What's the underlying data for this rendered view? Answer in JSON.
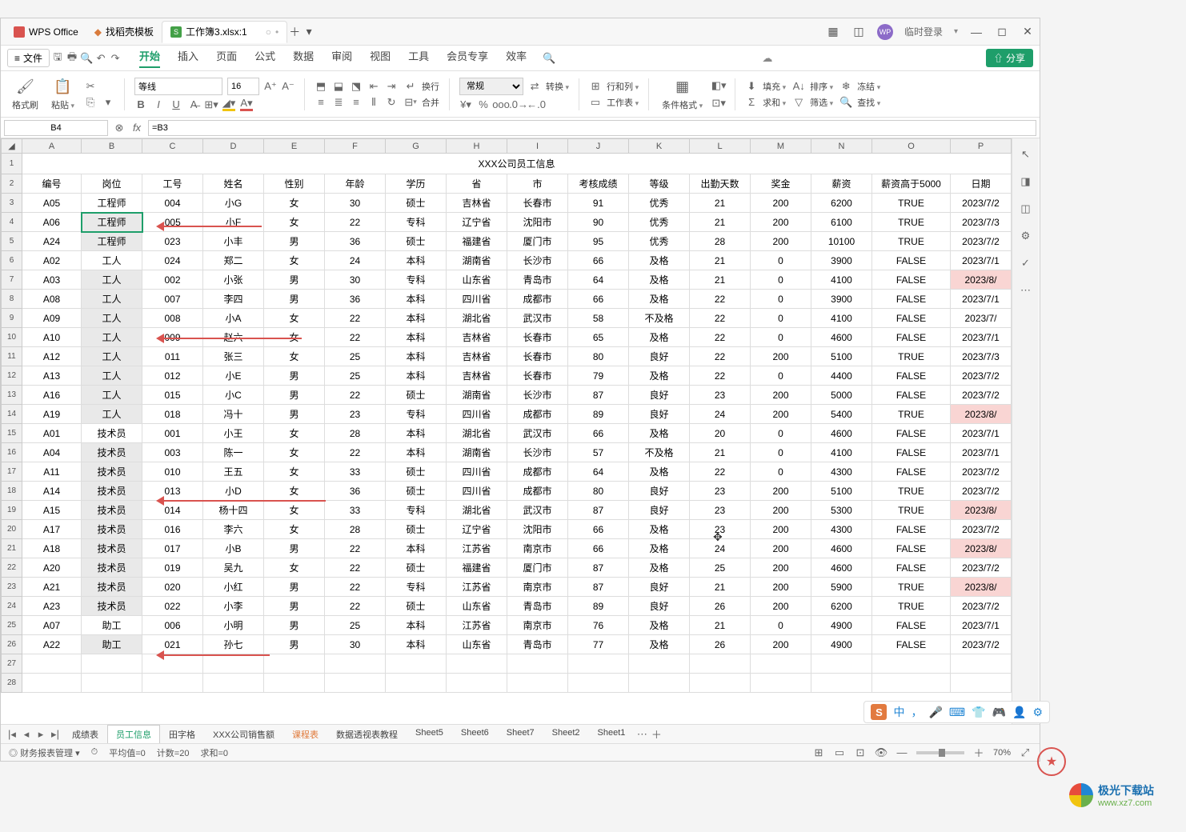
{
  "titlebar": {
    "app": "WPS Office",
    "tab_template": "找稻壳模板",
    "active_tab": "工作簿3.xlsx:1",
    "login": "临时登录"
  },
  "menubar": {
    "file": "文件",
    "tabs": [
      "开始",
      "插入",
      "页面",
      "公式",
      "数据",
      "审阅",
      "视图",
      "工具",
      "会员专享",
      "效率"
    ],
    "share": "分享"
  },
  "ribbon": {
    "format_painter": "格式刷",
    "paste": "粘贴",
    "font_name": "等线",
    "font_size": "16",
    "wrap": "换行",
    "merge": "合并",
    "number_fmt": "常规",
    "convert": "转换",
    "rowcol": "行和列",
    "sheet": "工作表",
    "cond_fmt": "条件格式",
    "fill": "填充",
    "sort": "排序",
    "freeze": "冻结",
    "sum": "求和",
    "filter": "筛选",
    "find": "查找"
  },
  "cellref": {
    "name": "B4",
    "formula": "=B3"
  },
  "columns": [
    "A",
    "B",
    "C",
    "D",
    "E",
    "F",
    "G",
    "H",
    "I",
    "J",
    "K",
    "L",
    "M",
    "N",
    "O",
    "P"
  ],
  "title": "XXX公司员工信息",
  "headers": [
    "编号",
    "岗位",
    "工号",
    "姓名",
    "性别",
    "年龄",
    "",
    "学历",
    "省",
    "市",
    "考核成绩",
    "等级",
    "出勤天数",
    "奖金",
    "薪资",
    "薪资高于5000",
    "日期"
  ],
  "rows": [
    {
      "n": 3,
      "g": 0,
      "hl": 0,
      "c": [
        "A05",
        "工程师",
        "004",
        "小G",
        "女",
        "30",
        "",
        "硕士",
        "吉林省",
        "长春市",
        "91",
        "优秀",
        "21",
        "200",
        "6200",
        "TRUE",
        "2023/7/2"
      ]
    },
    {
      "n": 4,
      "g": 1,
      "hl": 0,
      "sel": 1,
      "c": [
        "A06",
        "工程师",
        "005",
        "小F",
        "女",
        "22",
        "",
        "专科",
        "辽宁省",
        "沈阳市",
        "90",
        "优秀",
        "21",
        "200",
        "6100",
        "TRUE",
        "2023/7/3"
      ]
    },
    {
      "n": 5,
      "g": 1,
      "hl": 0,
      "c": [
        "A24",
        "工程师",
        "023",
        "小丰",
        "男",
        "36",
        "",
        "硕士",
        "福建省",
        "厦门市",
        "95",
        "优秀",
        "28",
        "200",
        "10100",
        "TRUE",
        "2023/7/2"
      ]
    },
    {
      "n": 6,
      "g": 0,
      "hl": 0,
      "c": [
        "A02",
        "工人",
        "024",
        "郑二",
        "女",
        "24",
        "",
        "本科",
        "湖南省",
        "长沙市",
        "66",
        "及格",
        "21",
        "0",
        "3900",
        "FALSE",
        "2023/7/1"
      ]
    },
    {
      "n": 7,
      "g": 1,
      "hl": 1,
      "c": [
        "A03",
        "工人",
        "002",
        "小张",
        "男",
        "30",
        "",
        "专科",
        "山东省",
        "青岛市",
        "64",
        "及格",
        "21",
        "0",
        "4100",
        "FALSE",
        "2023/8/"
      ]
    },
    {
      "n": 8,
      "g": 1,
      "hl": 0,
      "c": [
        "A08",
        "工人",
        "007",
        "李四",
        "男",
        "36",
        "",
        "本科",
        "四川省",
        "成都市",
        "66",
        "及格",
        "22",
        "0",
        "3900",
        "FALSE",
        "2023/7/1"
      ]
    },
    {
      "n": 9,
      "g": 1,
      "hl": 0,
      "c": [
        "A09",
        "工人",
        "008",
        "小A",
        "女",
        "22",
        "",
        "本科",
        "湖北省",
        "武汉市",
        "58",
        "不及格",
        "22",
        "0",
        "4100",
        "FALSE",
        "2023/7/"
      ]
    },
    {
      "n": 10,
      "g": 1,
      "hl": 0,
      "c": [
        "A10",
        "工人",
        "009",
        "赵六",
        "女",
        "22",
        "",
        "本科",
        "吉林省",
        "长春市",
        "65",
        "及格",
        "22",
        "0",
        "4600",
        "FALSE",
        "2023/7/1"
      ]
    },
    {
      "n": 11,
      "g": 1,
      "hl": 0,
      "c": [
        "A12",
        "工人",
        "011",
        "张三",
        "女",
        "25",
        "",
        "本科",
        "吉林省",
        "长春市",
        "80",
        "良好",
        "22",
        "200",
        "5100",
        "TRUE",
        "2023/7/3"
      ]
    },
    {
      "n": 12,
      "g": 1,
      "hl": 0,
      "c": [
        "A13",
        "工人",
        "012",
        "小E",
        "男",
        "25",
        "",
        "本科",
        "吉林省",
        "长春市",
        "79",
        "及格",
        "22",
        "0",
        "4400",
        "FALSE",
        "2023/7/2"
      ]
    },
    {
      "n": 13,
      "g": 1,
      "hl": 0,
      "c": [
        "A16",
        "工人",
        "015",
        "小C",
        "男",
        "22",
        "",
        "硕士",
        "湖南省",
        "长沙市",
        "87",
        "良好",
        "23",
        "200",
        "5000",
        "FALSE",
        "2023/7/2"
      ]
    },
    {
      "n": 14,
      "g": 1,
      "hl": 1,
      "c": [
        "A19",
        "工人",
        "018",
        "冯十",
        "男",
        "23",
        "",
        "专科",
        "四川省",
        "成都市",
        "89",
        "良好",
        "24",
        "200",
        "5400",
        "TRUE",
        "2023/8/"
      ]
    },
    {
      "n": 15,
      "g": 0,
      "hl": 0,
      "c": [
        "A01",
        "技术员",
        "001",
        "小王",
        "女",
        "28",
        "",
        "本科",
        "湖北省",
        "武汉市",
        "66",
        "及格",
        "20",
        "0",
        "4600",
        "FALSE",
        "2023/7/1"
      ]
    },
    {
      "n": 16,
      "g": 1,
      "hl": 0,
      "c": [
        "A04",
        "技术员",
        "003",
        "陈一",
        "女",
        "22",
        "",
        "本科",
        "湖南省",
        "长沙市",
        "57",
        "不及格",
        "21",
        "0",
        "4100",
        "FALSE",
        "2023/7/1"
      ]
    },
    {
      "n": 17,
      "g": 1,
      "hl": 0,
      "c": [
        "A11",
        "技术员",
        "010",
        "王五",
        "女",
        "33",
        "",
        "硕士",
        "四川省",
        "成都市",
        "64",
        "及格",
        "22",
        "0",
        "4300",
        "FALSE",
        "2023/7/2"
      ]
    },
    {
      "n": 18,
      "g": 1,
      "hl": 0,
      "c": [
        "A14",
        "技术员",
        "013",
        "小D",
        "女",
        "36",
        "",
        "硕士",
        "四川省",
        "成都市",
        "80",
        "良好",
        "23",
        "200",
        "5100",
        "TRUE",
        "2023/7/2"
      ]
    },
    {
      "n": 19,
      "g": 1,
      "hl": 1,
      "c": [
        "A15",
        "技术员",
        "014",
        "杨十四",
        "女",
        "33",
        "",
        "专科",
        "湖北省",
        "武汉市",
        "87",
        "良好",
        "23",
        "200",
        "5300",
        "TRUE",
        "2023/8/"
      ]
    },
    {
      "n": 20,
      "g": 1,
      "hl": 0,
      "c": [
        "A17",
        "技术员",
        "016",
        "李六",
        "女",
        "28",
        "",
        "硕士",
        "辽宁省",
        "沈阳市",
        "66",
        "及格",
        "23",
        "200",
        "4300",
        "FALSE",
        "2023/7/2"
      ]
    },
    {
      "n": 21,
      "g": 1,
      "hl": 1,
      "c": [
        "A18",
        "技术员",
        "017",
        "小B",
        "男",
        "22",
        "",
        "本科",
        "江苏省",
        "南京市",
        "66",
        "及格",
        "24",
        "200",
        "4600",
        "FALSE",
        "2023/8/"
      ]
    },
    {
      "n": 22,
      "g": 1,
      "hl": 0,
      "c": [
        "A20",
        "技术员",
        "019",
        "吴九",
        "女",
        "22",
        "",
        "硕士",
        "福建省",
        "厦门市",
        "87",
        "及格",
        "25",
        "200",
        "4600",
        "FALSE",
        "2023/7/2"
      ]
    },
    {
      "n": 23,
      "g": 1,
      "hl": 1,
      "c": [
        "A21",
        "技术员",
        "020",
        "小红",
        "男",
        "22",
        "",
        "专科",
        "江苏省",
        "南京市",
        "87",
        "良好",
        "21",
        "200",
        "5900",
        "TRUE",
        "2023/8/"
      ]
    },
    {
      "n": 24,
      "g": 1,
      "hl": 0,
      "c": [
        "A23",
        "技术员",
        "022",
        "小李",
        "男",
        "22",
        "",
        "硕士",
        "山东省",
        "青岛市",
        "89",
        "良好",
        "26",
        "200",
        "6200",
        "TRUE",
        "2023/7/2"
      ]
    },
    {
      "n": 25,
      "g": 0,
      "hl": 0,
      "c": [
        "A07",
        "助工",
        "006",
        "小明",
        "男",
        "25",
        "",
        "本科",
        "江苏省",
        "南京市",
        "76",
        "及格",
        "21",
        "0",
        "4900",
        "FALSE",
        "2023/7/1"
      ]
    },
    {
      "n": 26,
      "g": 1,
      "hl": 0,
      "c": [
        "A22",
        "助工",
        "021",
        "孙七",
        "男",
        "30",
        "",
        "本科",
        "山东省",
        "青岛市",
        "77",
        "及格",
        "26",
        "200",
        "4900",
        "FALSE",
        "2023/7/2"
      ]
    }
  ],
  "sheets": [
    "成绩表",
    "员工信息",
    "田字格",
    "XXX公司销售额",
    "课程表",
    "数据透视表教程",
    "Sheet5",
    "Sheet6",
    "Sheet7",
    "Sheet2",
    "Sheet1"
  ],
  "active_sheet": "员工信息",
  "orange_sheet": "课程表",
  "statusbar": {
    "mgmt": "财务报表管理",
    "avg": "平均值=0",
    "count": "计数=20",
    "sum": "求和=0",
    "zoom": "70%"
  },
  "ime": {
    "label": "中"
  },
  "watermark": {
    "brand": "极光下载站",
    "url": "www.xz7.com"
  }
}
